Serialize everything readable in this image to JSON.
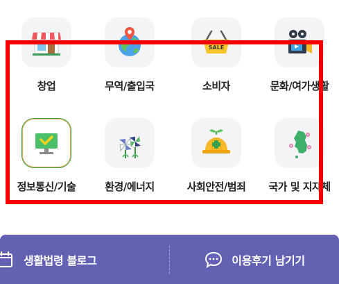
{
  "categories": [
    {
      "label": "창업",
      "icon": "storefront-icon"
    },
    {
      "label": "무역/출입국",
      "icon": "globe-pin-icon"
    },
    {
      "label": "소비자",
      "icon": "sale-basket-icon"
    },
    {
      "label": "문화/여가생활",
      "icon": "film-camera-icon"
    },
    {
      "label": "정보통신/기술",
      "icon": "monitor-check-icon"
    },
    {
      "label": "환경/에너지",
      "icon": "pinwheel-icon"
    },
    {
      "label": "사회안전/범죄",
      "icon": "safety-helmet-icon"
    },
    {
      "label": "국가 및 지자체",
      "icon": "korea-map-icon"
    }
  ],
  "sale_text": "SALE",
  "bottom_bar": {
    "blog_label": "생활법령 블로그",
    "review_label": "이용후기 남기기"
  },
  "colors": {
    "tile_bg": "#f4f4f6",
    "highlight": "#f40000",
    "bar_bg": "#6461b5",
    "active_border_green": "#3aa14a",
    "active_border_orange": "#f0a248"
  }
}
